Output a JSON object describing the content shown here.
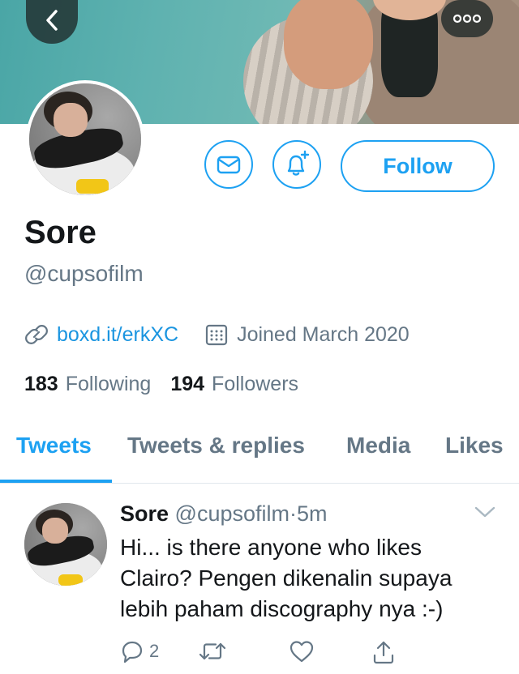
{
  "banner": {
    "back_icon": "chevron-left-icon",
    "more_icon": "more-dots-icon"
  },
  "actions": {
    "message_icon": "envelope-icon",
    "notify_icon": "bell-plus-icon",
    "follow_label": "Follow",
    "accent_color": "#1da1f2"
  },
  "profile": {
    "name": "Sore",
    "handle": "@cupsofilm",
    "link": "boxd.it/erkXC",
    "joined": "Joined March 2020",
    "following_count": "183",
    "following_label": "Following",
    "followers_count": "194",
    "followers_label": "Followers"
  },
  "tabs": [
    {
      "label": "Tweets",
      "active": true
    },
    {
      "label": "Tweets & replies",
      "active": false
    },
    {
      "label": "Media",
      "active": false
    },
    {
      "label": "Likes",
      "active": false
    }
  ],
  "tweet": {
    "name": "Sore",
    "handle": "@cupsofilm",
    "separator": "·",
    "time": "5m",
    "text": "Hi... is there anyone who likes Clairo? Pengen dikenalin supaya lebih paham discography nya :-)",
    "reply_count": "2"
  }
}
